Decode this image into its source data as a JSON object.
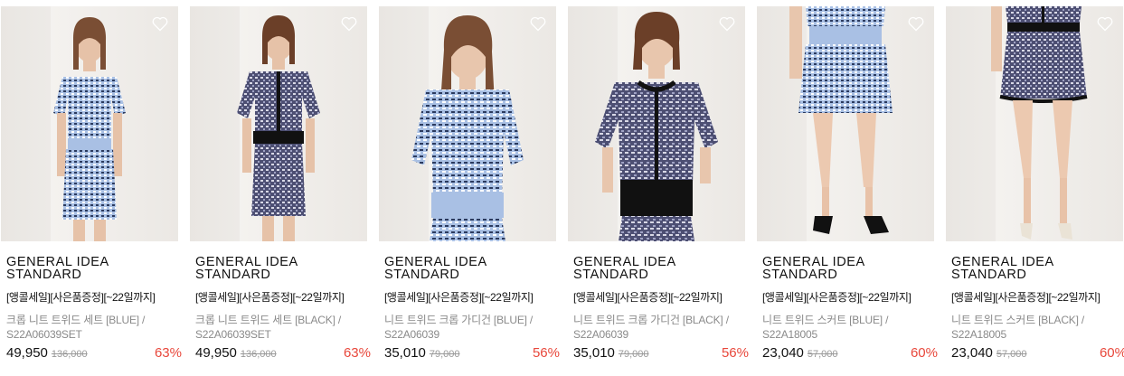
{
  "colors": {
    "discount": "#e8473b",
    "blue_knit": "#a8bfe3",
    "black_knit": "#4a4a6a",
    "trim_black": "#111111"
  },
  "products": [
    {
      "brand_line1": "GENERAL IDEA",
      "brand_line2": "STANDARD",
      "promo": "[앵콜세일][사은품증정][~22일까지]",
      "name_line1": "크롭 니트 트위드 세트 [BLUE] /",
      "name_line2": "S22A06039SET",
      "sale_price": "49,950",
      "original_price": "136,000",
      "discount": "63%",
      "image": "model-blue-set-full",
      "wishlist_icon": "heart-outline-icon"
    },
    {
      "brand_line1": "GENERAL IDEA",
      "brand_line2": "STANDARD",
      "promo": "[앵콜세일][사은품증정][~22일까지]",
      "name_line1": "크롭 니트 트위드 세트 [BLACK] /",
      "name_line2": "S22A06039SET",
      "sale_price": "49,950",
      "original_price": "136,000",
      "discount": "63%",
      "image": "model-black-set-full",
      "wishlist_icon": "heart-outline-icon"
    },
    {
      "brand_line1": "GENERAL IDEA",
      "brand_line2": "STANDARD",
      "promo": "[앵콜세일][사은품증정][~22일까지]",
      "name_line1": "니트 트위드 크롭 가디건 [BLUE] /",
      "name_line2": "S22A06039",
      "sale_price": "35,010",
      "original_price": "79,000",
      "discount": "56%",
      "image": "model-blue-cardigan-close",
      "wishlist_icon": "heart-outline-icon"
    },
    {
      "brand_line1": "GENERAL IDEA",
      "brand_line2": "STANDARD",
      "promo": "[앵콜세일][사은품증정][~22일까지]",
      "name_line1": "니트 트위드 크롭 가디건 [BLACK] /",
      "name_line2": "S22A06039",
      "sale_price": "35,010",
      "original_price": "79,000",
      "discount": "56%",
      "image": "model-black-cardigan-close",
      "wishlist_icon": "heart-outline-icon"
    },
    {
      "brand_line1": "GENERAL IDEA",
      "brand_line2": "STANDARD",
      "promo": "[앵콜세일][사은품증정][~22일까지]",
      "name_line1": "니트 트위드 스커트 [BLUE] /",
      "name_line2": "S22A18005",
      "sale_price": "23,040",
      "original_price": "57,000",
      "discount": "60%",
      "image": "model-blue-skirt-legs",
      "wishlist_icon": "heart-outline-icon"
    },
    {
      "brand_line1": "GENERAL IDEA",
      "brand_line2": "STANDARD",
      "promo": "[앵콜세일][사은품증정][~22일까지]",
      "name_line1": "니트 트위드 스커트 [BLACK] /",
      "name_line2": "S22A18005",
      "sale_price": "23,040",
      "original_price": "57,000",
      "discount": "60%",
      "image": "model-black-skirt-legs",
      "wishlist_icon": "heart-outline-icon"
    }
  ]
}
